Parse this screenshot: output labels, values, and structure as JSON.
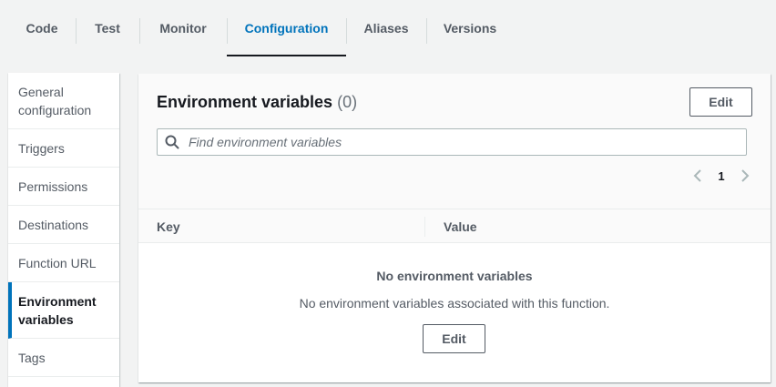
{
  "tabs": [
    {
      "label": "Code"
    },
    {
      "label": "Test"
    },
    {
      "label": "Monitor"
    },
    {
      "label": "Configuration",
      "active": true
    },
    {
      "label": "Aliases"
    },
    {
      "label": "Versions"
    }
  ],
  "sidenav": {
    "items": [
      {
        "label": "General configuration"
      },
      {
        "label": "Triggers"
      },
      {
        "label": "Permissions"
      },
      {
        "label": "Destinations"
      },
      {
        "label": "Function URL"
      },
      {
        "label": "Environment variables",
        "active": true
      },
      {
        "label": "Tags"
      }
    ]
  },
  "panel": {
    "title": "Environment variables",
    "count": "(0)",
    "edit_label": "Edit",
    "search_placeholder": "Find environment variables",
    "search_value": "",
    "page": "1",
    "columns": {
      "key": "Key",
      "value": "Value"
    },
    "empty_title": "No environment variables",
    "empty_desc": "No environment variables associated with this function.",
    "empty_edit_label": "Edit"
  },
  "colors": {
    "accent": "#0073bb",
    "text": "#16191f",
    "muted": "#545b64"
  }
}
